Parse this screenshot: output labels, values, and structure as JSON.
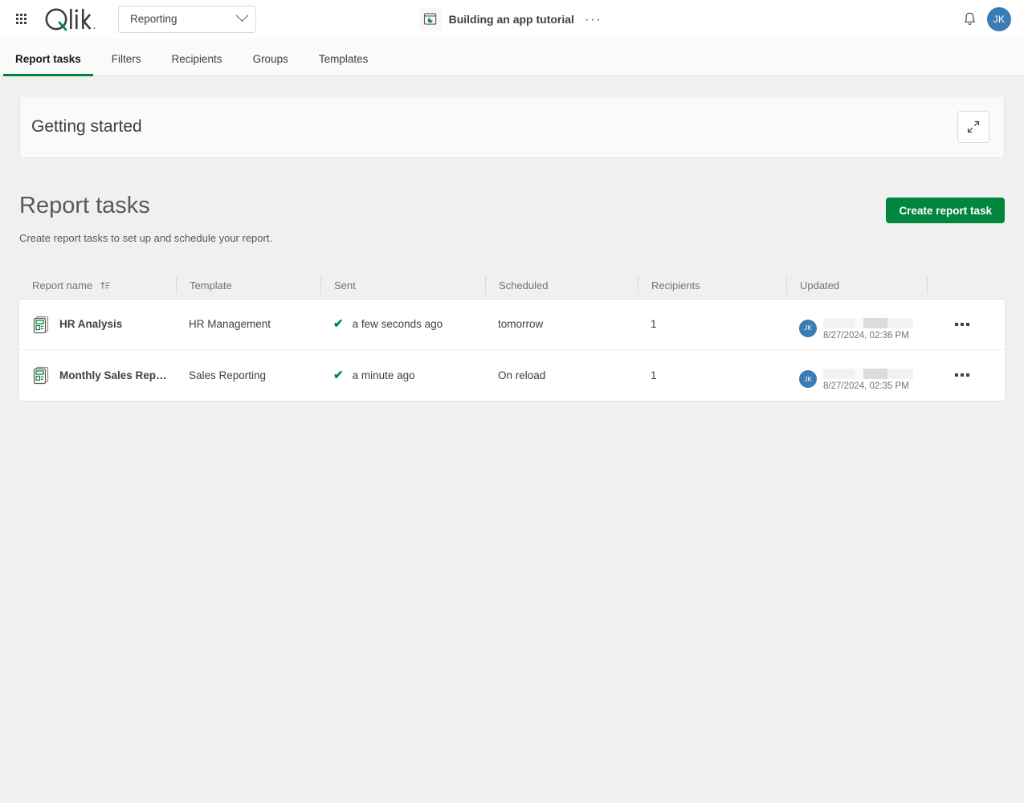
{
  "topbar": {
    "launcher_label": "App launcher",
    "logo_text": "Qlik",
    "space_selector": {
      "value": "Reporting",
      "icon": "chevron-down-icon"
    },
    "app": {
      "icon": "app-chart-icon",
      "title": "Building an app tutorial",
      "more_label": "···"
    },
    "notifications_icon": "bell-icon",
    "avatar_initials": "JK"
  },
  "tabs": [
    {
      "label": "Report tasks",
      "active": true
    },
    {
      "label": "Filters",
      "active": false
    },
    {
      "label": "Recipients",
      "active": false
    },
    {
      "label": "Groups",
      "active": false
    },
    {
      "label": "Templates",
      "active": false
    }
  ],
  "getting_started": {
    "title": "Getting started",
    "expand_icon": "expand-diagonal-icon"
  },
  "page": {
    "title": "Report tasks",
    "subtitle": "Create report tasks to set up and schedule your report.",
    "create_button": "Create report task"
  },
  "table": {
    "columns": [
      {
        "label": "Report name",
        "sort": "sort-ascending-icon"
      },
      {
        "label": "Template"
      },
      {
        "label": "Sent"
      },
      {
        "label": "Scheduled"
      },
      {
        "label": "Recipients"
      },
      {
        "label": "Updated"
      },
      {
        "label": ""
      }
    ],
    "rows": [
      {
        "icon": "report-document-icon",
        "name": "HR Analysis",
        "template": "HR Management",
        "sent_status_icon": "check-icon",
        "sent": "a few seconds ago",
        "scheduled": "tomorrow",
        "recipients": "1",
        "updated_avatar": "JK",
        "updated_time": "8/27/2024, 02:36 PM",
        "menu_icon": "kebab-menu-icon"
      },
      {
        "icon": "report-document-icon",
        "name": "Monthly Sales Rep…",
        "template": "Sales Reporting",
        "sent_status_icon": "check-icon",
        "sent": "a minute ago",
        "scheduled": "On reload",
        "recipients": "1",
        "updated_avatar": "JK",
        "updated_time": "8/27/2024, 02:35 PM",
        "menu_icon": "kebab-menu-icon"
      }
    ]
  },
  "colors": {
    "brand_green": "#00873d",
    "avatar_blue": "#3b7cb5",
    "page_bg": "#f0f0f0",
    "text": "#404040"
  }
}
